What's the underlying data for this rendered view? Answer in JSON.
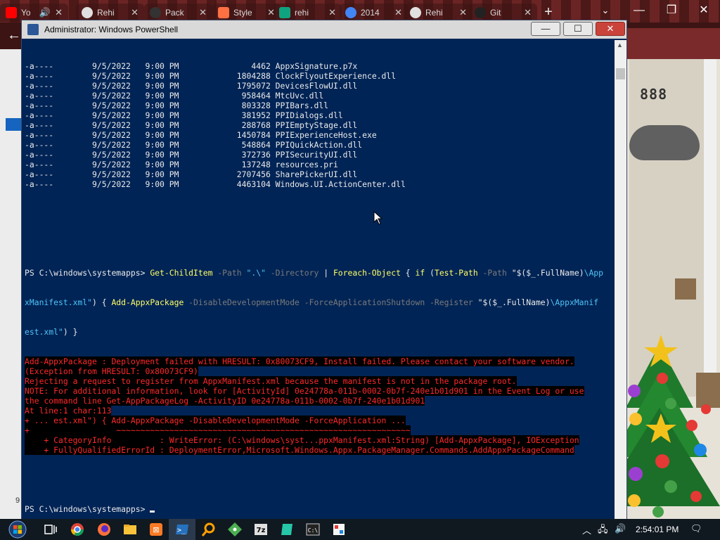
{
  "browser": {
    "tabs": [
      {
        "title": "Yo",
        "color": "#ff0000"
      },
      {
        "title": "Rehi",
        "color": "#e0e0e0"
      },
      {
        "title": "Pack",
        "color": "#333333"
      },
      {
        "title": "Style",
        "color": "#ff7043"
      },
      {
        "title": "rehi",
        "color": "#10a37f"
      },
      {
        "title": "2014",
        "color": "#4285f4"
      },
      {
        "title": "Rehi",
        "color": "#e0e0e0"
      },
      {
        "title": "Git",
        "color": "#222222"
      }
    ],
    "new_tab": "+",
    "minimize": "—",
    "restore": "❐",
    "close": "✕",
    "side_number": "9"
  },
  "game": {
    "digits": "888"
  },
  "powershell": {
    "title": "Administrator: Windows PowerShell",
    "controls": {
      "minimize": "—",
      "maximize": "☐",
      "close": "✕"
    },
    "listing": [
      {
        "mode": "-a----",
        "date": "9/5/2022",
        "time": "9:00 PM",
        "length": "4462",
        "name": "AppxSignature.p7x"
      },
      {
        "mode": "-a----",
        "date": "9/5/2022",
        "time": "9:00 PM",
        "length": "1804288",
        "name": "ClockFlyoutExperience.dll"
      },
      {
        "mode": "-a----",
        "date": "9/5/2022",
        "time": "9:00 PM",
        "length": "1795072",
        "name": "DevicesFlowUI.dll"
      },
      {
        "mode": "-a----",
        "date": "9/5/2022",
        "time": "9:00 PM",
        "length": "958464",
        "name": "MtcUvc.dll"
      },
      {
        "mode": "-a----",
        "date": "9/5/2022",
        "time": "9:00 PM",
        "length": "803328",
        "name": "PPIBars.dll"
      },
      {
        "mode": "-a----",
        "date": "9/5/2022",
        "time": "9:00 PM",
        "length": "381952",
        "name": "PPIDialogs.dll"
      },
      {
        "mode": "-a----",
        "date": "9/5/2022",
        "time": "9:00 PM",
        "length": "288768",
        "name": "PPIEmptyStage.dll"
      },
      {
        "mode": "-a----",
        "date": "9/5/2022",
        "time": "9:00 PM",
        "length": "1450784",
        "name": "PPIExperienceHost.exe"
      },
      {
        "mode": "-a----",
        "date": "9/5/2022",
        "time": "9:00 PM",
        "length": "548864",
        "name": "PPIQuickAction.dll"
      },
      {
        "mode": "-a----",
        "date": "9/5/2022",
        "time": "9:00 PM",
        "length": "372736",
        "name": "PPISecurityUI.dll"
      },
      {
        "mode": "-a----",
        "date": "9/5/2022",
        "time": "9:00 PM",
        "length": "137248",
        "name": "resources.pri"
      },
      {
        "mode": "-a----",
        "date": "9/5/2022",
        "time": "9:00 PM",
        "length": "2707456",
        "name": "SharePickerUI.dll"
      },
      {
        "mode": "-a----",
        "date": "9/5/2022",
        "time": "9:00 PM",
        "length": "4463104",
        "name": "Windows.UI.ActionCenter.dll"
      }
    ],
    "command": {
      "prompt": "PS C:\\windows\\systemapps> ",
      "l1": [
        {
          "t": "Get-ChildItem",
          "c": "y"
        },
        {
          "t": " -Path ",
          "c": "g"
        },
        {
          "t": "\".\\\"",
          "c": "c"
        },
        {
          "t": " -Directory",
          "c": "g"
        },
        {
          "t": " | ",
          "c": "w"
        },
        {
          "t": "Foreach-Object",
          "c": "y"
        },
        {
          "t": " { ",
          "c": "w"
        },
        {
          "t": "if",
          "c": "y"
        },
        {
          "t": " (",
          "c": "w"
        },
        {
          "t": "Test-Path",
          "c": "y"
        },
        {
          "t": " -Path ",
          "c": "g"
        },
        {
          "t": "\"$($_.FullName)",
          "c": "w"
        },
        {
          "t": "\\App",
          "c": "c"
        }
      ],
      "l2": [
        {
          "t": "xManifest.xml\"",
          "c": "c"
        },
        {
          "t": ") { ",
          "c": "w"
        },
        {
          "t": "Add-AppxPackage",
          "c": "y"
        },
        {
          "t": " -DisableDevelopmentMode -ForceApplicationShutdown -Register ",
          "c": "g"
        },
        {
          "t": "\"$($_.FullName)",
          "c": "w"
        },
        {
          "t": "\\AppxManif",
          "c": "c"
        }
      ],
      "l3": [
        {
          "t": "est.xml\"",
          "c": "c"
        },
        {
          "t": ") }",
          "c": "w"
        }
      ]
    },
    "errors": [
      "Add-AppxPackage : Deployment failed with HRESULT: 0x80073CF9, Install failed. Please contact your software vendor.",
      "(Exception from HRESULT: 0x80073CF9)",
      "Rejecting a request to register from AppxManifest.xml because the manifest is not in the package root.",
      "NOTE: For additional information, look for [ActivityId] 0e24778a-011b-0002-0b7f-240e1b01d901 in the Event Log or use",
      "the command line Get-AppPackageLog -ActivityID 0e24778a-011b-0002-0b7f-240e1b01d901",
      "At line:1 char:113",
      "+ ... est.xml\") { Add-AppxPackage -DisableDevelopmentMode -ForceApplication ...",
      "+                  ~~~~~~~~~~~~~~~~~~~~~~~~~~~~~~~~~~~~~~~~~~~~~~~~~~~~~~~~~~~~~",
      "    + CategoryInfo          : WriteError: (C:\\windows\\syst...ppxManifest.xml:String) [Add-AppxPackage], IOException",
      "    + FullyQualifiedErrorId : DeploymentError,Microsoft.Windows.Appx.PackageManager.Commands.AddAppxPackageCommand"
    ],
    "final_prompt": "PS C:\\windows\\systemapps> "
  },
  "taskbar": {
    "clock": "2:54:01 PM",
    "apps": [
      "task-view",
      "chrome",
      "firefox",
      "file-explorer",
      "xampp",
      "powershell",
      "search-tool",
      "git",
      "7zip",
      "notepad",
      "terminal",
      "paint"
    ]
  }
}
